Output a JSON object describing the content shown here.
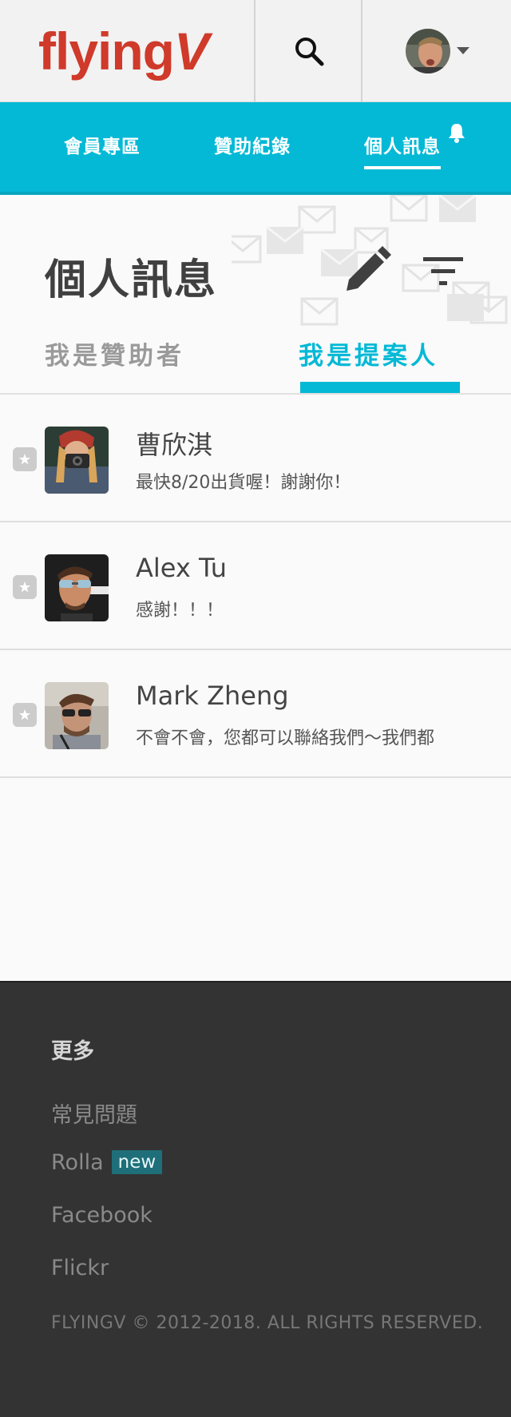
{
  "brand": {
    "logo_main": "flying",
    "logo_v": "V"
  },
  "nav": {
    "items": [
      {
        "label": "會員專區"
      },
      {
        "label": "贊助紀錄"
      },
      {
        "label": "個人訊息"
      }
    ],
    "active_index": 2
  },
  "page": {
    "title": "個人訊息",
    "role_tabs": [
      {
        "label": "我是贊助者"
      },
      {
        "label": "我是提案人"
      }
    ],
    "active_role_index": 1
  },
  "messages": [
    {
      "name": "曹欣淇",
      "preview": "最快8/20出貨喔！謝謝你！"
    },
    {
      "name": "Alex Tu",
      "preview": "感謝！！！"
    },
    {
      "name": "Mark Zheng",
      "preview": "不會不會，您都可以聯絡我們～我們都"
    }
  ],
  "footer": {
    "title": "更多",
    "links": [
      {
        "label": "常見問題"
      },
      {
        "label": "Rolla",
        "badge": "new"
      },
      {
        "label": "Facebook"
      },
      {
        "label": "Flickr"
      }
    ],
    "copyright": "FLYINGV © 2012-2018. ALL RIGHTS RESERVED."
  },
  "colors": {
    "brand_red": "#cf3a2a",
    "accent_cyan": "#03b9d6",
    "footer_bg": "#333333",
    "badge_teal": "#1e6f79"
  },
  "icons": [
    "search-icon",
    "caret-down-icon",
    "bell-icon",
    "edit-pencil-icon",
    "filter-icon",
    "star-icon",
    "envelope-icon"
  ]
}
